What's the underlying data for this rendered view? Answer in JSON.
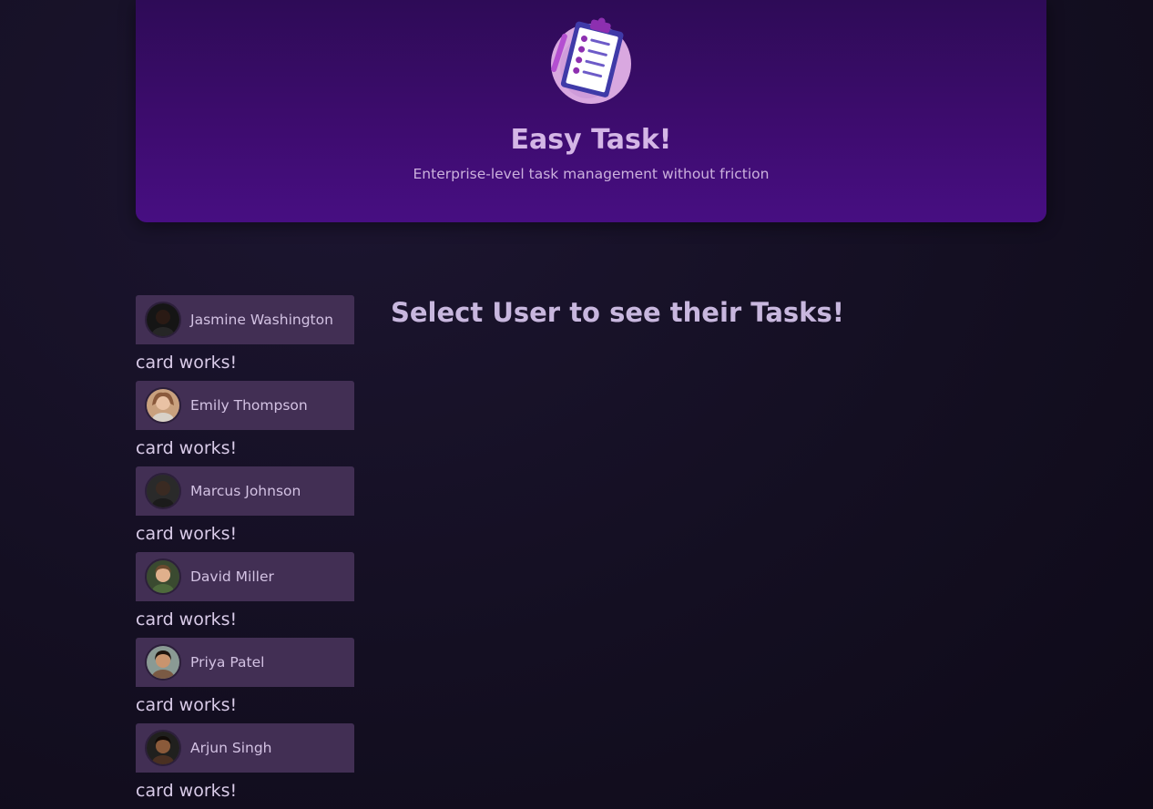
{
  "header": {
    "title": "Easy Task!",
    "subtitle": "Enterprise-level task management without friction",
    "logo_icon": "clipboard-task-list-icon"
  },
  "users": [
    {
      "name": "Jasmine Washington",
      "note": "card works!",
      "avatar_color": "#2a1a14"
    },
    {
      "name": "Emily Thompson",
      "note": "card works!",
      "avatar_color": "#8a5a3c"
    },
    {
      "name": "Marcus Johnson",
      "note": "card works!",
      "avatar_color": "#3a2a22"
    },
    {
      "name": "David Miller",
      "note": "card works!",
      "avatar_color": "#6b4a2e"
    },
    {
      "name": "Priya Patel",
      "note": "card works!",
      "avatar_color": "#7a5a44"
    },
    {
      "name": "Arjun Singh",
      "note": "card works!",
      "avatar_color": "#4a3022"
    }
  ],
  "main": {
    "fallback": "Select User to see their Tasks!"
  },
  "colors": {
    "header_top": "#2e0b57",
    "header_bottom": "#470e82",
    "card_bg": "#422f54",
    "page_bg": "#140f22"
  }
}
